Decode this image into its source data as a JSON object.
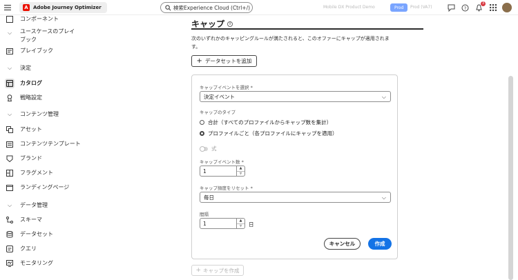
{
  "topbar": {
    "app_title": "Adobe Journey Optimizer",
    "app_logo_letter": "A",
    "search_placeholder": "検索Experience Cloud (Ctrl+/)",
    "org_label": "Mobile DX Product Demo",
    "sandbox_label": "Prod",
    "sandbox_name": "Prod (VA7)",
    "notification_count": "3"
  },
  "sidebar": {
    "items": [
      {
        "label": "コンポーネント",
        "icon": "components-icon",
        "kind": "item"
      },
      {
        "label": "ユースケースのプレイ\nブック",
        "icon": "chevron-down-icon",
        "kind": "section"
      },
      {
        "label": "プレイブック",
        "icon": "playbook-icon",
        "kind": "item"
      },
      {
        "label": "決定",
        "icon": "chevron-down-icon",
        "kind": "section"
      },
      {
        "label": "カタログ",
        "icon": "catalog-icon",
        "kind": "item",
        "selected": true
      },
      {
        "label": "戦略設定",
        "icon": "strategy-icon",
        "kind": "item"
      },
      {
        "label": "コンテンツ管理",
        "icon": "chevron-down-icon",
        "kind": "section"
      },
      {
        "label": "アセット",
        "icon": "assets-icon",
        "kind": "item"
      },
      {
        "label": "コンテンツテンプレート",
        "icon": "template-icon",
        "kind": "item"
      },
      {
        "label": "ブランド",
        "icon": "brand-icon",
        "kind": "item"
      },
      {
        "label": "フラグメント",
        "icon": "fragment-icon",
        "kind": "item"
      },
      {
        "label": "ランディングページ",
        "icon": "landing-page-icon",
        "kind": "item"
      },
      {
        "label": "データ管理",
        "icon": "chevron-down-icon",
        "kind": "section"
      },
      {
        "label": "スキーマ",
        "icon": "schema-icon",
        "kind": "item"
      },
      {
        "label": "データセット",
        "icon": "dataset-icon",
        "kind": "item"
      },
      {
        "label": "クエリ",
        "icon": "query-icon",
        "kind": "item"
      },
      {
        "label": "モニタリング",
        "icon": "monitoring-icon",
        "kind": "item"
      }
    ]
  },
  "main": {
    "title": "キャップ",
    "description": "次のいずれかのキャッピングルールが満たされると、このオファーにキャップが適用されます。",
    "add_dataset_label": "データセットを追加",
    "form": {
      "cap_event_label": "キャップイベントを選択",
      "cap_event_value": "決定イベント",
      "cap_type_label": "キャップのタイプ",
      "radio_total": "合計（すべてのプロファイルからキャップ数を集計）",
      "radio_per_profile": "プロファイルごと（各プロファイルにキャップを適用）",
      "expression_toggle_label": "式",
      "cap_count_label": "キャップイベント数",
      "cap_count_value": "1",
      "reset_frequency_label": "キャップ頻度をリセット",
      "reset_frequency_value": "毎日",
      "interval_label": "間隔",
      "interval_value": "1",
      "interval_unit": "日",
      "required_mark": "*",
      "cancel_label": "キャンセル",
      "create_label": "作成"
    },
    "create_cap_label": "キャップを作成"
  },
  "colors": {
    "accent": "#1473e6",
    "brand_red": "#eb1000"
  }
}
